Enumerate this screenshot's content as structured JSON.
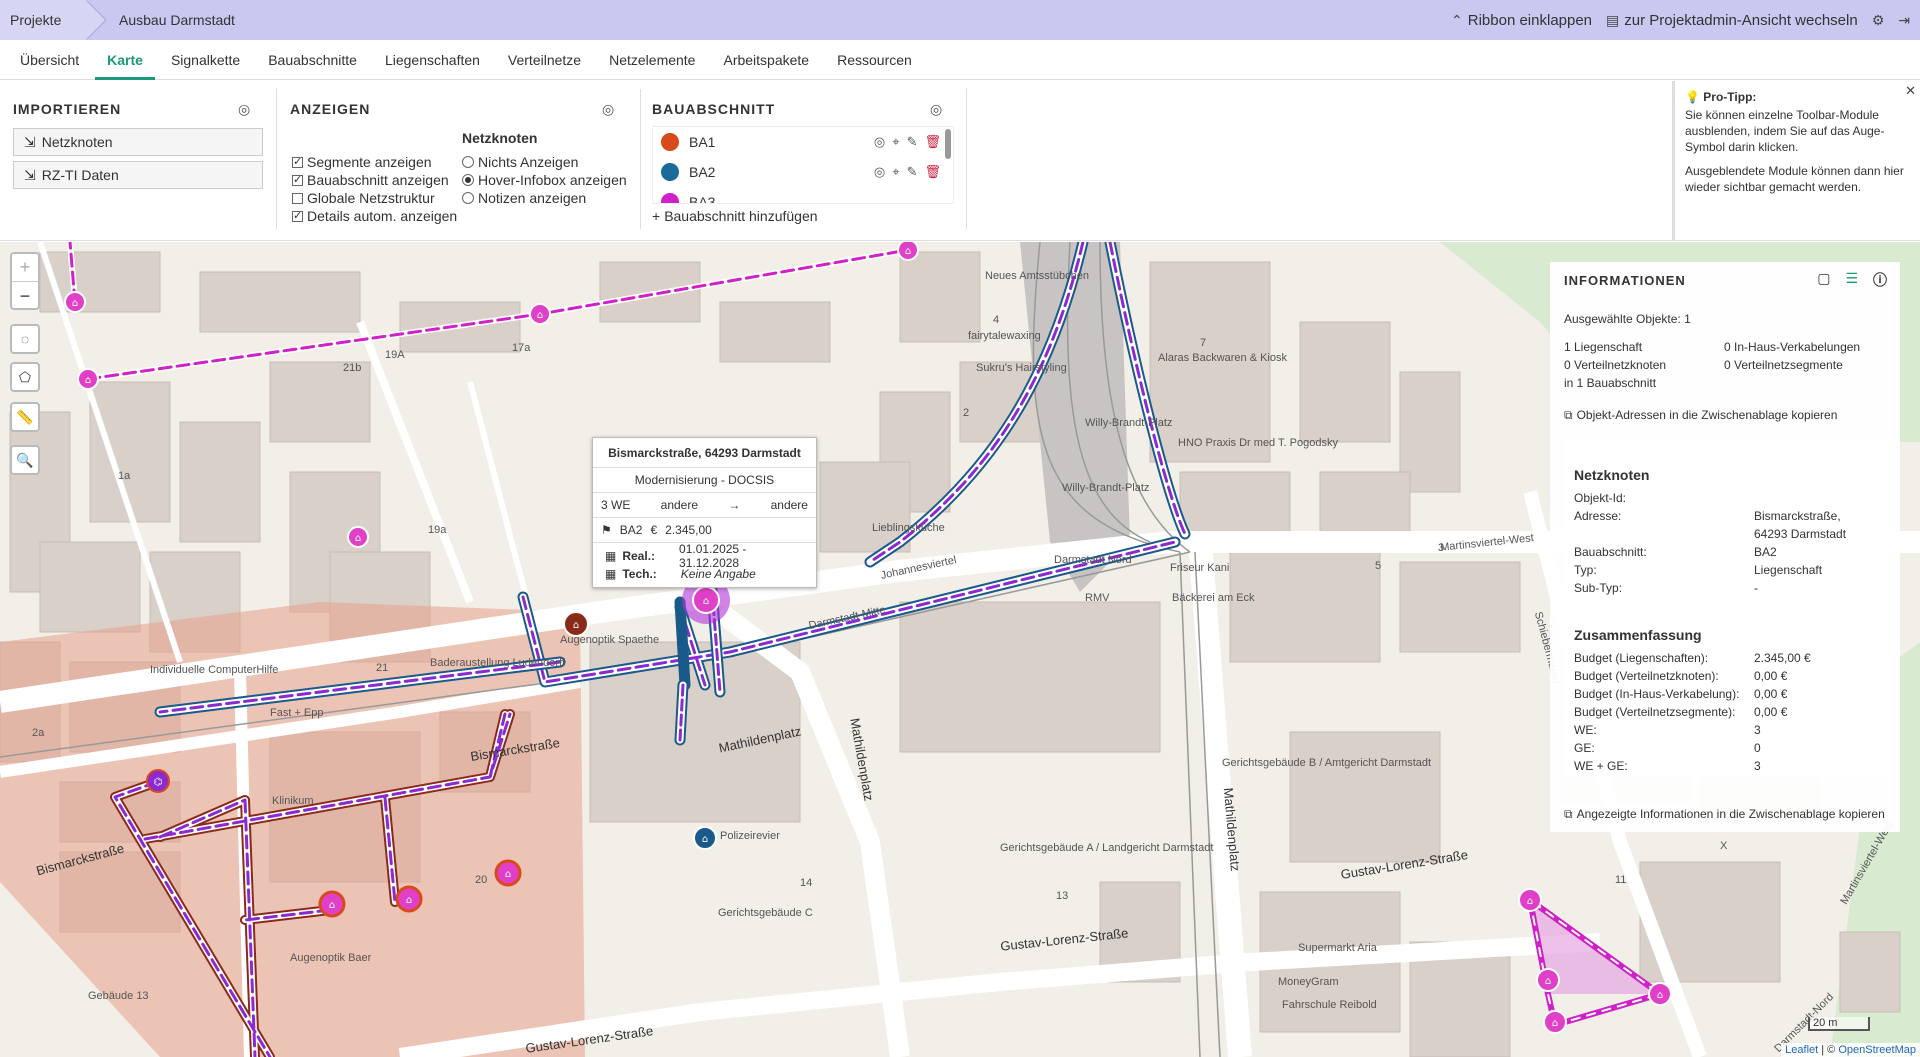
{
  "breadcrumb": [
    "Projekte",
    "Ausbau Darmstadt"
  ],
  "header_actions": {
    "collapse": "Ribbon einklappen",
    "switch": "zur Projektadmin-Ansicht wechseln"
  },
  "tabs": [
    "Übersicht",
    "Karte",
    "Signalkette",
    "Bauabschnitte",
    "Liegenschaften",
    "Verteilnetze",
    "Netzelemente",
    "Arbeitspakete",
    "Ressourcen"
  ],
  "importieren": {
    "title": "IMPORTIEREN",
    "buttons": [
      "Netzknoten",
      "RZ-TI Daten"
    ]
  },
  "anzeigen": {
    "title": "ANZEIGEN",
    "checkboxes": [
      {
        "label": "Segmente anzeigen",
        "checked": true
      },
      {
        "label": "Bauabschnitt anzeigen",
        "checked": true
      },
      {
        "label": "Globale Netzstruktur",
        "checked": false
      },
      {
        "label": "Details autom. anzeigen",
        "checked": true
      }
    ],
    "netzknoten_title": "Netzknoten",
    "radios": [
      {
        "label": "Nichts Anzeigen",
        "selected": false
      },
      {
        "label": "Hover-Infobox anzeigen",
        "selected": true
      },
      {
        "label": "Notizen anzeigen",
        "selected": false
      }
    ]
  },
  "bauabschnitt": {
    "title": "BAUABSCHNITT",
    "items": [
      {
        "label": "BA1",
        "color": "#d94a1a"
      },
      {
        "label": "BA2",
        "color": "#1a6a9a"
      },
      {
        "label": "BA3",
        "color": "#d020c8"
      }
    ],
    "add": "Bauabschnitt hinzufügen"
  },
  "tip": {
    "title": "Pro-Tipp:",
    "p1": "Sie können einzelne Toolbar-Module ausblenden, indem Sie auf das Auge-Symbol darin klicken.",
    "p2": "Ausgeblendete Module können dann hier wieder sichtbar gemacht werden."
  },
  "popup": {
    "address": "Bismarckstraße, 64293 Darmstadt",
    "type": "Modernisierung - DOCSIS",
    "we": "3 WE",
    "from": "andere",
    "arrow": "→",
    "to": "andere",
    "ba": "BA2",
    "currency": "€",
    "budget": "2.345,00",
    "real_label": "Real.:",
    "real_value": "01.01.2025 - 31.12.2028",
    "tech_label": "Tech.:",
    "tech_value": "Keine Angabe"
  },
  "info": {
    "title": "INFORMATIONEN",
    "selected": "Ausgewählte Objekte: 1",
    "counts": [
      "1 Liegenschaft",
      "0 In-Haus-Verkabelungen",
      "0 Verteilnetzknoten",
      "0 Verteilnetzsegmente",
      "in 1 Bauabschnitt"
    ],
    "copy_addresses": "Objekt-Adressen in die Zwischenablage kopieren",
    "netzknoten_title": "Netzknoten",
    "netzknoten": [
      {
        "k": "Objekt-Id:",
        "v": ""
      },
      {
        "k": "Adresse:",
        "v": "Bismarckstraße,"
      },
      {
        "k": "",
        "v": "64293 Darmstadt"
      },
      {
        "k": "Bauabschnitt:",
        "v": "BA2"
      },
      {
        "k": "Typ:",
        "v": "Liegenschaft"
      },
      {
        "k": "Sub-Typ:",
        "v": "-"
      }
    ],
    "summary_title": "Zusammenfassung",
    "summary": [
      {
        "k": "Budget (Liegenschaften):",
        "v": "2.345,00 €"
      },
      {
        "k": "Budget (Verteilnetzknoten):",
        "v": "0,00 €"
      },
      {
        "k": "Budget (In-Haus-Verkabelung):",
        "v": "0,00 €"
      },
      {
        "k": "Budget (Verteilnetzsegmente):",
        "v": "0,00 €"
      },
      {
        "k": "WE:",
        "v": "3"
      },
      {
        "k": "GE:",
        "v": "0"
      },
      {
        "k": "WE + GE:",
        "v": "3"
      }
    ],
    "copy_info": "Angezeigte Informationen in die Zwischenablage kopieren"
  },
  "map_labels": {
    "streets": [
      "Bismarckstraße",
      "Bismarckstraße",
      "Mathildenplatz",
      "Mathildenplatz",
      "Gustav-Lorenz-Straße",
      "Gustav-Lorenz-Straße",
      "Gustav-Lorenz-Straße",
      "Mathildenplatz",
      "Darmstadt-Mitte",
      "Johannesviertel",
      "Martinsviertel-West",
      "Schiebermauer"
    ],
    "pois": [
      "Neues Amtsstübchen",
      "Alaras Backwaren & Kiosk",
      "fairytalewaxing",
      "Sukru's Hairstyling",
      "Lieblingsküche",
      "HNO Praxis Dr med T. Pogodsky",
      "Friseur Kani",
      "Bäckerei am Eck",
      "Willy-Brandt-Platz",
      "Willy-Brandt-Platz",
      "Darmstadt Nord",
      "RMV",
      "Augenoptik Spaethe",
      "Baderaustellung Ludendorff",
      "Individuelle ComputerHilfe",
      "Fast + Epp",
      "Klinikum",
      "Polizeirevier",
      "Gerichtsgebäude C",
      "Gerichtsgebäude A / Landgericht Darmstadt",
      "Gerichtsgebäude B / Amtgericht Darmstadt",
      "Augenoptik Baer",
      "Gebäude 13",
      "Supermarkt Aria",
      "MoneyGram",
      "Fahrschule Reibold",
      "Darmstadt-Nord",
      "Martinsviertel-West"
    ],
    "numbers": [
      "19A",
      "17a",
      "21b",
      "19a",
      "1a",
      "21",
      "2a",
      "4",
      "2",
      "7",
      "5",
      "3",
      "14",
      "13",
      "20",
      "11",
      "X"
    ]
  },
  "scale": "20 m",
  "attribution_leaflet": "Leaflet",
  "attribution_sep": " | © ",
  "attribution_osm": "OpenStreetMap",
  "colors": {
    "accent": "#1a9a7a",
    "ba1": "#d94a1a",
    "ba2": "#1a6a9a",
    "ba3": "#d020c8",
    "header": "#c8c8f0"
  }
}
